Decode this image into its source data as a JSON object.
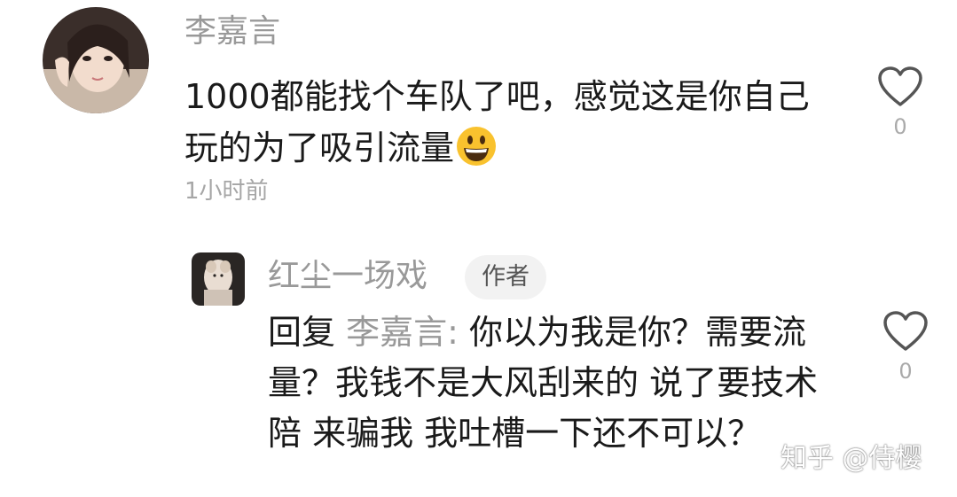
{
  "comment": {
    "username": "李嘉言",
    "text": "1000都能找个车队了吧，感觉这是你自己玩的为了吸引流量",
    "emoji": "grinning-face-emoji",
    "time": "1小时前",
    "likes": "0"
  },
  "reply": {
    "username": "红尘一场戏",
    "badge": "作者",
    "prefix": "回复",
    "target": "李嘉言:",
    "text": "你以为我是你？需要流量？我钱不是大风刮来的 说了要技术陪 来骗我 我吐槽一下还不可以？",
    "likes": "0"
  },
  "watermark": "知乎 @侍樱",
  "colors": {
    "name": "#999999",
    "text": "#1a1a1a",
    "badge_bg": "#f2f2f2"
  }
}
